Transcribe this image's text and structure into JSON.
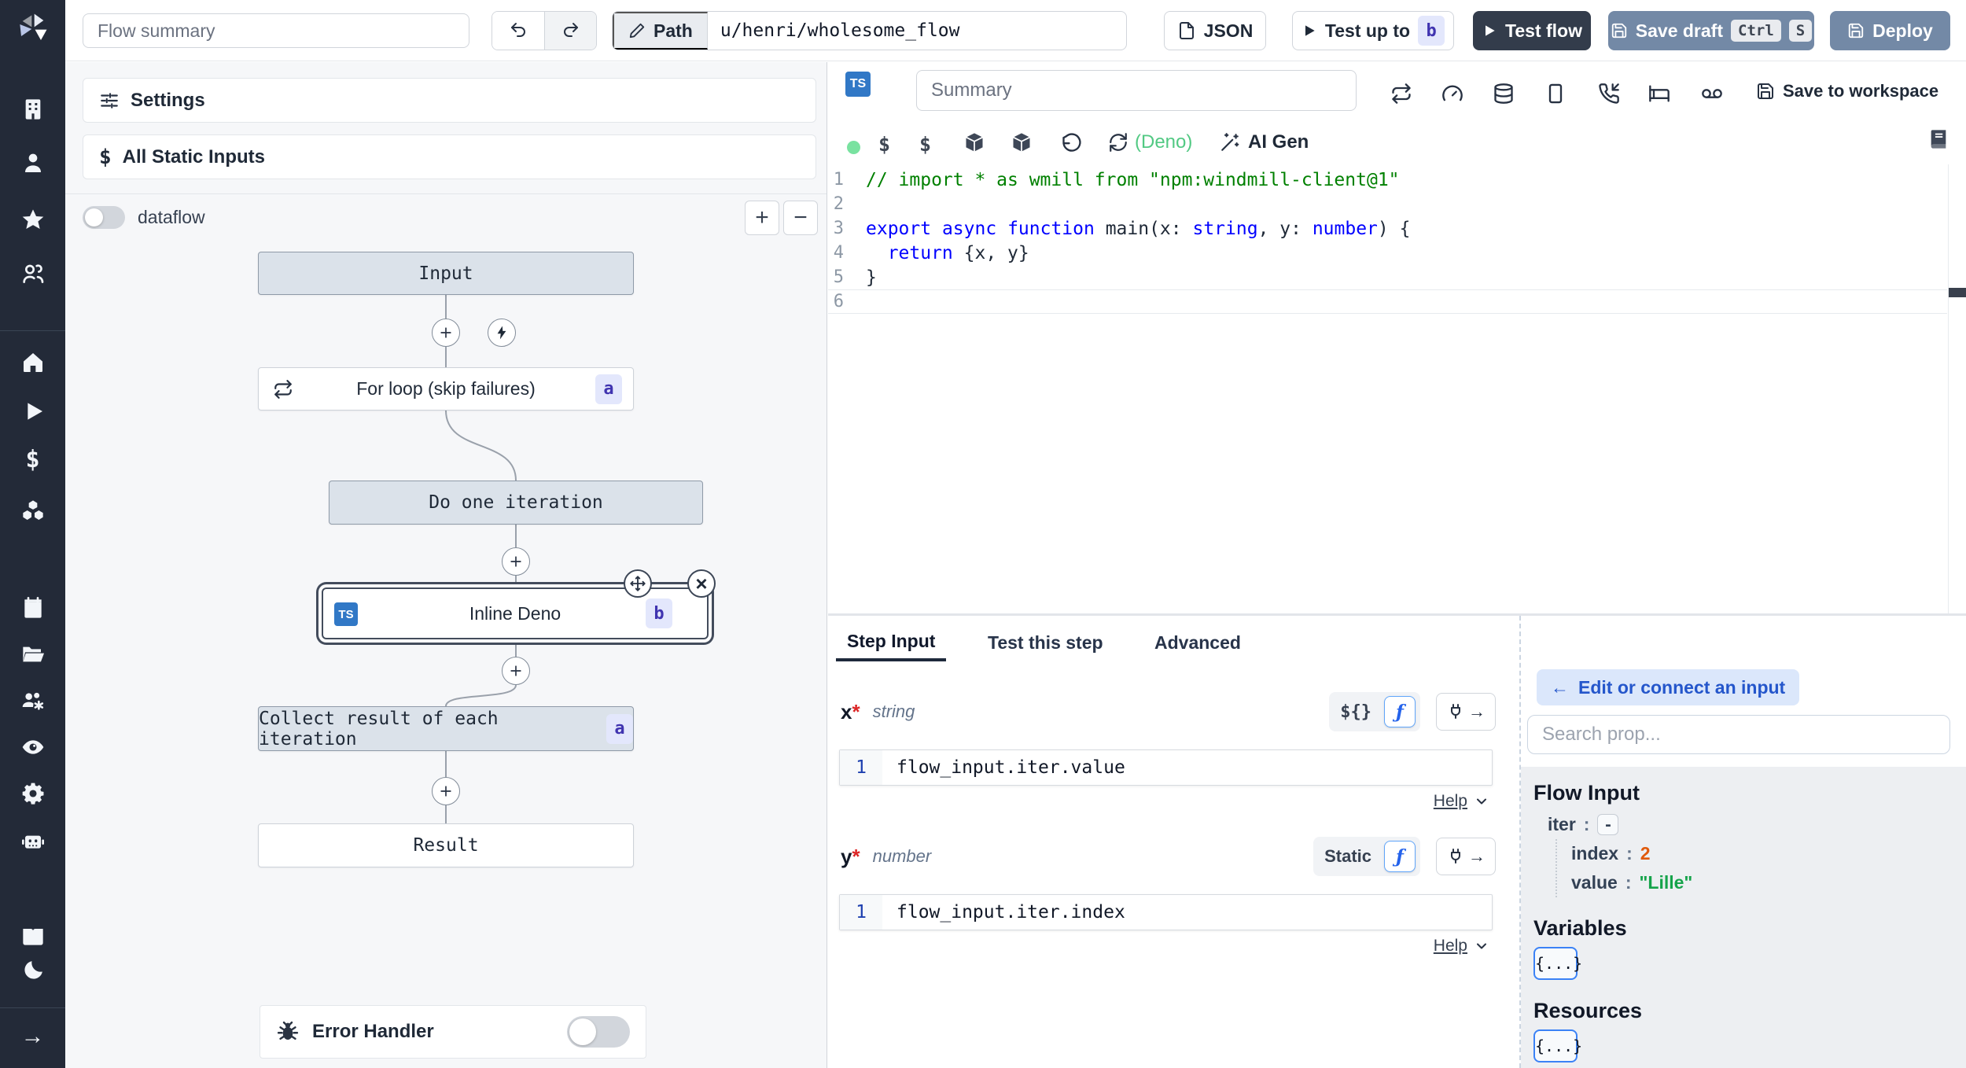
{
  "topbar": {
    "flow_summary_placeholder": "Flow summary",
    "path_label": "Path",
    "path_value": "u/henri/wholesome_flow",
    "json_label": "JSON",
    "test_up_to_label": "Test up to",
    "test_up_to_badge": "b",
    "test_flow_label": "Test flow",
    "save_draft_label": "Save draft",
    "save_draft_shortcut": [
      "Ctrl",
      "S"
    ],
    "deploy_label": "Deploy"
  },
  "sidebar": {
    "icons": [
      "windmill-logo",
      "building",
      "user",
      "star",
      "users",
      "home",
      "play",
      "dollar",
      "boxes",
      "calendar",
      "folder-open",
      "users-cog",
      "eye",
      "settings",
      "robot",
      "book-open",
      "moon",
      "arrow-right"
    ]
  },
  "flow_panel": {
    "settings_label": "Settings",
    "all_static_inputs_label": "All Static Inputs",
    "dataflow_label": "dataflow",
    "zoom_in": "+",
    "zoom_out": "−",
    "nodes": {
      "input": "Input",
      "for_loop": "For loop (skip failures)",
      "for_loop_badge": "a",
      "do_one_iteration": "Do one iteration",
      "inline_deno": "Inline Deno",
      "inline_deno_badge": "b",
      "inline_deno_lang": "TS",
      "collect": "Collect result of each iteration",
      "collect_badge": "a",
      "result": "Result"
    },
    "error_handler_label": "Error Handler"
  },
  "editor": {
    "lang_badge": "TS",
    "summary_placeholder": "Summary",
    "save_to_workspace_label": "Save to workspace",
    "dollar_signs": [
      "$",
      "$"
    ],
    "runtime_label": "(Deno)",
    "ai_gen_label": "AI Gen",
    "lines": [
      {
        "n": "1",
        "tokens": [
          {
            "c": "comment",
            "t": "// import * as wmill from \"npm:windmill-client@1\""
          }
        ]
      },
      {
        "n": "2",
        "tokens": []
      },
      {
        "n": "3",
        "tokens": [
          {
            "c": "kw",
            "t": "export"
          },
          {
            "c": "pl",
            "t": " "
          },
          {
            "c": "kw",
            "t": "async"
          },
          {
            "c": "pl",
            "t": " "
          },
          {
            "c": "kw",
            "t": "function"
          },
          {
            "c": "pl",
            "t": " main(x: "
          },
          {
            "c": "kw",
            "t": "string"
          },
          {
            "c": "pl",
            "t": ", y: "
          },
          {
            "c": "kw",
            "t": "number"
          },
          {
            "c": "pl",
            "t": ") {"
          }
        ]
      },
      {
        "n": "4",
        "tokens": [
          {
            "c": "kw",
            "t": "  return"
          },
          {
            "c": "pl",
            "t": " {x, y}"
          }
        ]
      },
      {
        "n": "5",
        "tokens": [
          {
            "c": "pl",
            "t": "}"
          }
        ]
      },
      {
        "n": "6",
        "tokens": [],
        "current": true
      }
    ]
  },
  "step_panel": {
    "tabs": [
      "Step Input",
      "Test this step",
      "Advanced"
    ],
    "active_tab": "Step Input",
    "fields": {
      "x": {
        "name": "x",
        "required": "*",
        "type": "string",
        "mode": "${}",
        "line_no": "1",
        "expression": "flow_input.iter.value",
        "help_label": "Help"
      },
      "y": {
        "name": "y",
        "required": "*",
        "type": "number",
        "mode": "Static",
        "line_no": "1",
        "expression": "flow_input.iter.index",
        "help_label": "Help"
      }
    }
  },
  "prop_picker": {
    "edit_connect_label": "Edit or connect an input",
    "search_placeholder": "Search prop...",
    "flow_input_title": "Flow Input",
    "colon": ":",
    "tree": {
      "iter_key": "iter",
      "iter_collapse": "-",
      "index_key": "index",
      "index_value": "2",
      "value_key": "value",
      "value_value": "\"Lille\""
    },
    "variables_title": "Variables",
    "variables_button": "{...}",
    "resources_title": "Resources",
    "resources_button": "{...}"
  },
  "colors": {
    "sidebar_bg": "#232a38",
    "primary_button": "#7389a6",
    "dark_button": "#333c4b",
    "badge_bg": "#e3e7fc",
    "badge_text": "#4034b0",
    "ts_badge": "#3178c6",
    "deno_green": "#52c983",
    "index_orange": "#e0590b",
    "value_green": "#15a34a",
    "node_gray": "#dbe2ea"
  }
}
